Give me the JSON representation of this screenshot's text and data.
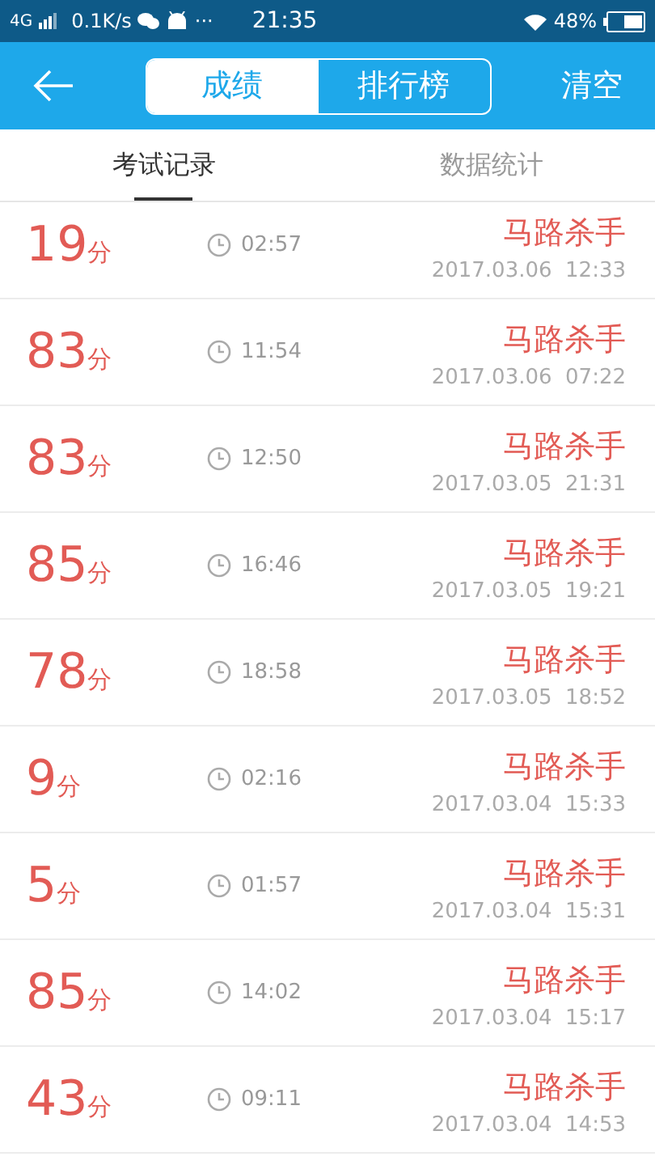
{
  "status_bar": {
    "network": "4G",
    "speed": "0.1K/s",
    "more": "···",
    "time": "21:35",
    "battery": "48%"
  },
  "header": {
    "segments": [
      {
        "label": "成绩",
        "selected": true
      },
      {
        "label": "排行榜",
        "selected": false
      }
    ],
    "action": "清空"
  },
  "tabs": [
    {
      "label": "考试记录",
      "selected": true
    },
    {
      "label": "数据统计",
      "selected": false
    }
  ],
  "records": [
    {
      "score": "19",
      "unit": "分",
      "duration": "02:57",
      "name": "马路杀手",
      "datetime": "2017.03.06  12:33"
    },
    {
      "score": "83",
      "unit": "分",
      "duration": "11:54",
      "name": "马路杀手",
      "datetime": "2017.03.06  07:22"
    },
    {
      "score": "83",
      "unit": "分",
      "duration": "12:50",
      "name": "马路杀手",
      "datetime": "2017.03.05  21:31"
    },
    {
      "score": "85",
      "unit": "分",
      "duration": "16:46",
      "name": "马路杀手",
      "datetime": "2017.03.05  19:21"
    },
    {
      "score": "78",
      "unit": "分",
      "duration": "18:58",
      "name": "马路杀手",
      "datetime": "2017.03.05  18:52"
    },
    {
      "score": "9",
      "unit": "分",
      "duration": "02:16",
      "name": "马路杀手",
      "datetime": "2017.03.04  15:33"
    },
    {
      "score": "5",
      "unit": "分",
      "duration": "01:57",
      "name": "马路杀手",
      "datetime": "2017.03.04  15:31"
    },
    {
      "score": "85",
      "unit": "分",
      "duration": "14:02",
      "name": "马路杀手",
      "datetime": "2017.03.04  15:17"
    },
    {
      "score": "43",
      "unit": "分",
      "duration": "09:11",
      "name": "马路杀手",
      "datetime": "2017.03.04  14:53"
    }
  ]
}
